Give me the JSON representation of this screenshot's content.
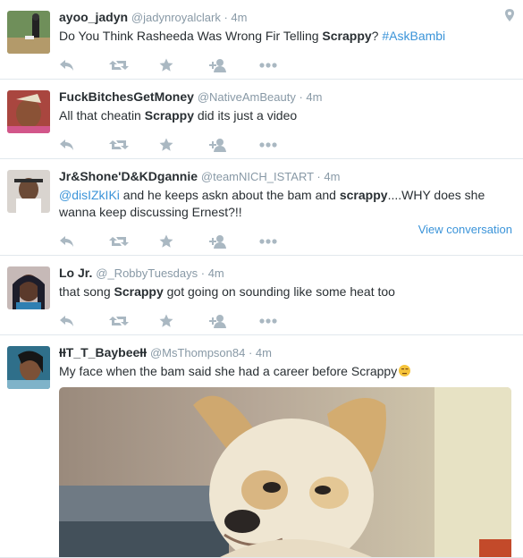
{
  "tweets": [
    {
      "name": "ayoo_jadyn",
      "handle": "@jadynroyalclark",
      "time": "4m",
      "text": [
        {
          "t": "Do You Think Rasheeda Was Wrong Fir Telling "
        },
        {
          "b": "Scrappy"
        },
        {
          "t": "?  "
        },
        {
          "l": "#AskBambi"
        }
      ],
      "has_geo_icon": true
    },
    {
      "name": "FuckBitchesGetMoney",
      "handle": "@NativeAmBeauty",
      "time": "4m",
      "text": [
        {
          "t": "All that cheatin "
        },
        {
          "b": "Scrappy"
        },
        {
          "t": " did its just a video"
        }
      ]
    },
    {
      "name": "Jr&Shone'D&KDgannie",
      "handle": "@teamNICH_ISTART",
      "time": "4m",
      "text": [
        {
          "l": "@disIZkIKi"
        },
        {
          "t": " and he keeps askn about the bam and "
        },
        {
          "b": "scrappy"
        },
        {
          "t": "....WHY does she wanna keep discussing Ernest?!!"
        }
      ],
      "view_conversation": "View conversation"
    },
    {
      "name": "Lo Jr.",
      "handle": "@_RobbyTuesdays",
      "time": "4m",
      "text": [
        {
          "t": "that song "
        },
        {
          "b": "Scrappy"
        },
        {
          "t": " got going on sounding like some heat too"
        }
      ]
    },
    {
      "name": "ƗƗT_T_BaybeeƗƗ",
      "handle": "@MsThompson84",
      "time": "4m",
      "text": [
        {
          "t": "My face when the bam said she had a career before Scrappy"
        }
      ],
      "has_emoji": true,
      "has_media": true
    }
  ],
  "actions": [
    "reply-icon",
    "retweet-icon",
    "favorite-icon",
    "follow-icon",
    "more-icon"
  ],
  "colors": {
    "link": "#3b94d9",
    "meta": "#8899a6",
    "icon": "#aab8c2",
    "border": "#e1e8ed"
  }
}
